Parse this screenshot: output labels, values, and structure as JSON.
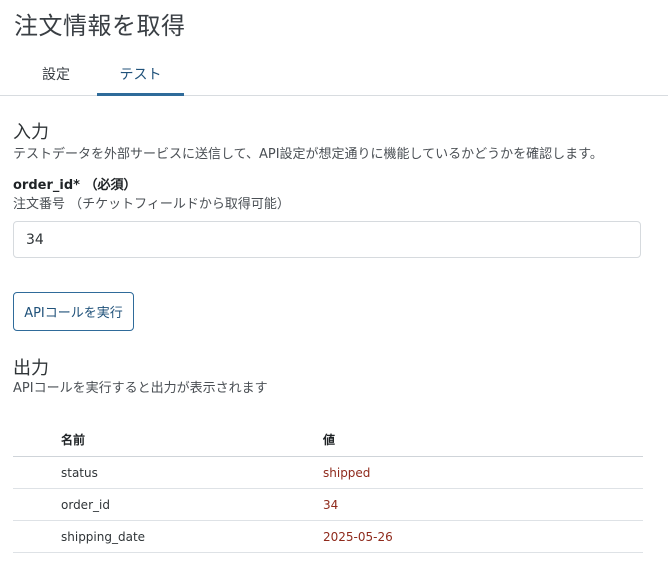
{
  "page": {
    "title": "注文情報を取得"
  },
  "tabs": [
    {
      "label": "設定",
      "active": false
    },
    {
      "label": "テスト",
      "active": true
    }
  ],
  "input_section": {
    "heading": "入力",
    "description": "テストデータを外部サービスに送信して、API設定が想定通りに機能しているかどうかを確認します。",
    "field": {
      "label": "order_id* （必須）",
      "help": "注文番号 （チケットフィールドから取得可能）",
      "value": "34",
      "placeholder": ""
    },
    "run_button_label": "APIコールを実行"
  },
  "output_section": {
    "heading": "出力",
    "description": "APIコールを実行すると出力が表示されます",
    "table": {
      "headers": {
        "name": "名前",
        "value": "値"
      },
      "rows": [
        {
          "name": "status",
          "value": "shipped"
        },
        {
          "name": "order_id",
          "value": "34"
        },
        {
          "name": "shipping_date",
          "value": "2025-05-26"
        }
      ]
    }
  },
  "colors": {
    "accent": "#2f6b9a",
    "value_text": "#8f2a1c"
  }
}
